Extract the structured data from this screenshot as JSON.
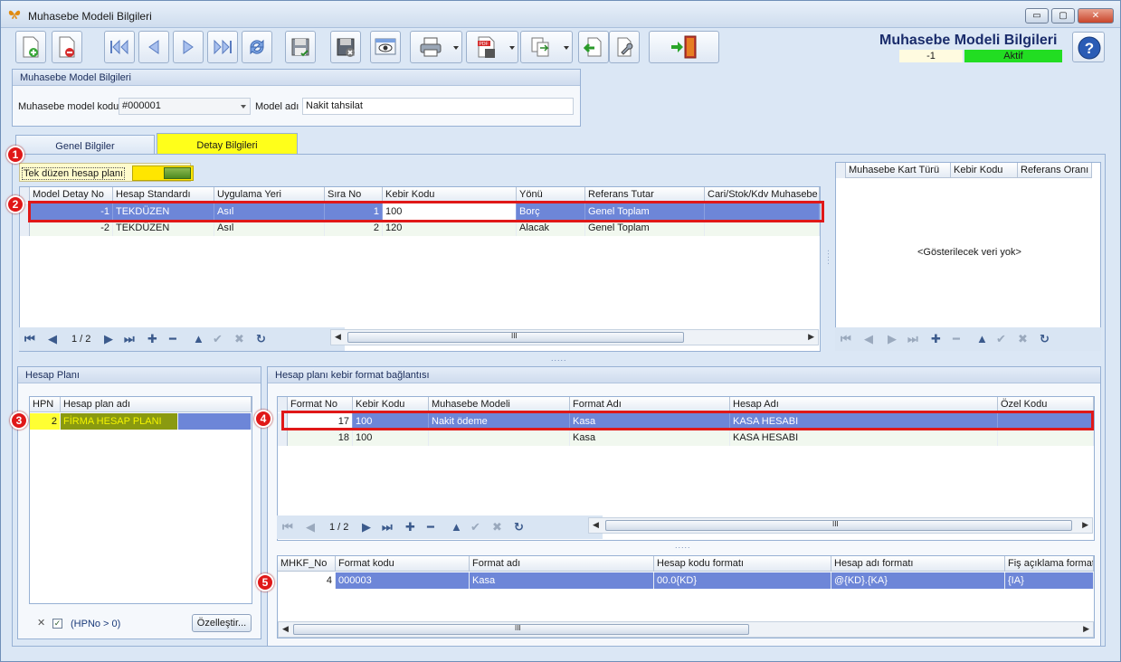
{
  "window": {
    "title": "Muhasebe Modeli Bilgileri",
    "controls": {
      "minimize": "▭",
      "maximize": "▢",
      "close": "✕"
    }
  },
  "header": {
    "title": "Muhasebe Modeli Bilgileri",
    "record_id": "-1",
    "status": "Aktif",
    "status_color": "#22dd22",
    "help_label": "?"
  },
  "toolbar": {
    "buttons": [
      "new-icon",
      "delete-icon",
      "first-record-icon",
      "previous-record-icon",
      "next-record-icon",
      "last-record-icon",
      "refresh-icon",
      "save-icon",
      "save-close-icon",
      "preview-icon",
      "print-icon",
      "pdf-export-icon",
      "copy-icon",
      "import-icon",
      "settings-icon",
      "exit-icon"
    ]
  },
  "model_group": {
    "title": "Muhasebe Model Bilgileri",
    "code_label": "Muhasebe model kodu",
    "code_value": "#000001",
    "name_label": "Model adı",
    "name_value": "Nakit tahsilat"
  },
  "tabs": [
    {
      "label": "Genel Bilgiler",
      "active": false
    },
    {
      "label": "Detay Bilgileri",
      "active": true
    }
  ],
  "toggle": {
    "label": "Tek düzen hesap planı",
    "on": true
  },
  "detail_grid": {
    "columns": [
      "Model Detay No",
      "Hesap Standardı",
      "Uygulama Yeri",
      "Sıra No",
      "Kebir Kodu",
      "Yönü",
      "Referans Tutar",
      "Cari/Stok/Kdv Muhasebe T"
    ],
    "rows": [
      [
        "-1",
        "TEKDÜZEN",
        "Asıl",
        "1",
        "100",
        "Borç",
        "Genel Toplam",
        ""
      ],
      [
        "-2",
        "TEKDÜZEN",
        "Asıl",
        "2",
        "120",
        "Alacak",
        "Genel Toplam",
        ""
      ]
    ],
    "page": "1 / 2"
  },
  "card_grid": {
    "columns": [
      "Muhasebe Kart Türü",
      "Kebir Kodu",
      "Referans Oranı"
    ],
    "empty_text": "<Gösterilecek veri yok>"
  },
  "hesap_plani": {
    "title": "Hesap Planı",
    "columns": [
      "HPN",
      "Hesap plan adı"
    ],
    "rows": [
      [
        "2",
        "FİRMA HESAP PLANI"
      ]
    ],
    "filter_close": "✕",
    "filter_check": "✓",
    "filter_text": "(HPNo > 0)",
    "customize_label": "Özelleştir..."
  },
  "format_group": {
    "title": "Hesap planı kebir format bağlantısı",
    "columns": [
      "Format No",
      "Kebir Kodu",
      "Muhasebe Modeli",
      "Format Adı",
      "Hesap Adı",
      "Özel Kodu"
    ],
    "rows": [
      [
        "17",
        "100",
        "Nakit ödeme",
        "Kasa",
        "KASA HESABI",
        ""
      ],
      [
        "18",
        "100",
        "",
        "Kasa",
        "KASA HESABI",
        ""
      ]
    ],
    "page": "1 / 2"
  },
  "mhkf_grid": {
    "columns": [
      "MHKF_No",
      "Format kodu",
      "Format adı",
      "Hesap kodu formatı",
      "Hesap adı formatı",
      "Fiş açıklama formatı"
    ],
    "rows": [
      [
        "4",
        "000003",
        "Kasa",
        "00.0{KD}",
        "@{KD}.{KA}",
        "{IA}"
      ]
    ]
  },
  "scroll_grip": "III",
  "splitter_grip": ".....",
  "nav": {
    "first": "⏮",
    "prev": "◀",
    "next": "▶",
    "last": "⏭",
    "add": "✚",
    "remove": "━",
    "up": "▲",
    "accept": "✔",
    "cancel": "✖",
    "refresh": "↻"
  },
  "badges": [
    "1",
    "2",
    "3",
    "4",
    "5"
  ]
}
